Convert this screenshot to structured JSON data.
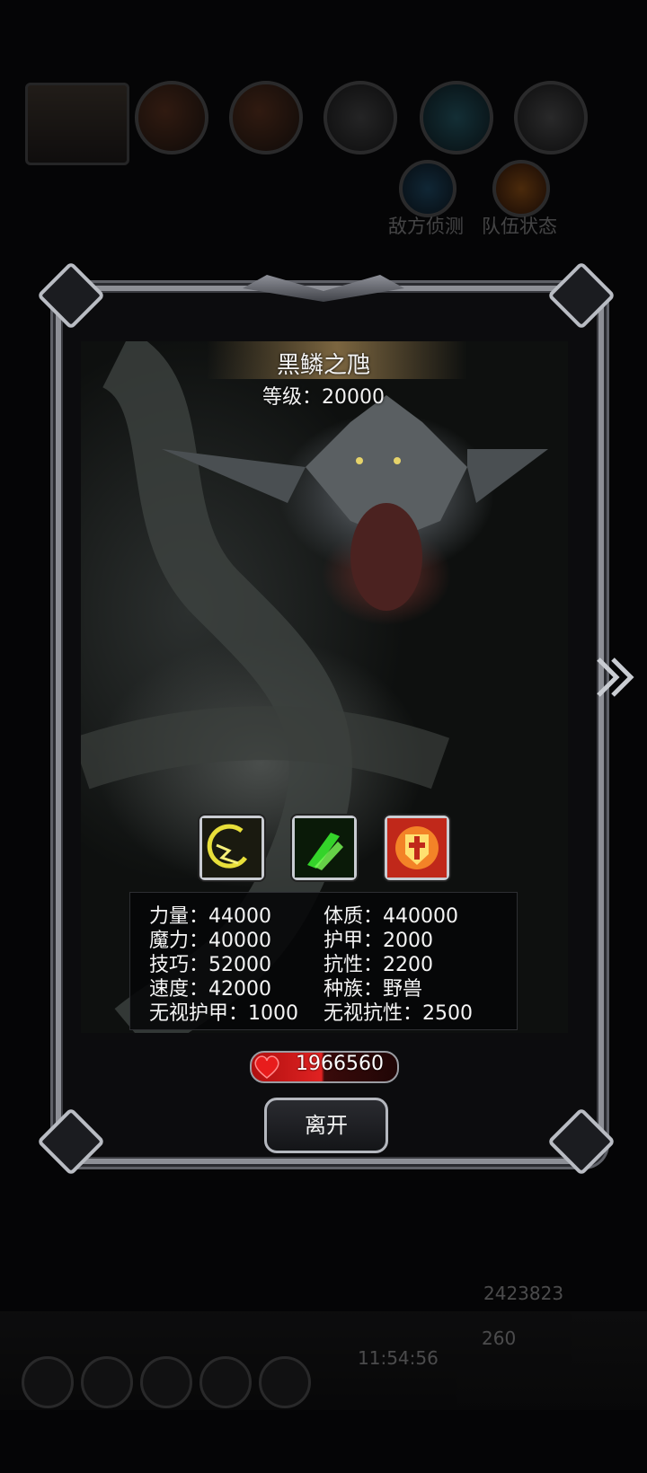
{
  "background": {
    "enemy_scan_label": "敌方侦测",
    "team_status_label": "队伍状态",
    "gold_amount": "2423823",
    "gem_amount": "260",
    "clock": "11:54:56"
  },
  "monster": {
    "name": "黑鳞之虺",
    "level_label": "等级",
    "level_value": "20000"
  },
  "skills": [
    {
      "icon": "lightning-crescent-icon"
    },
    {
      "icon": "green-claw-icon"
    },
    {
      "icon": "holy-shield-icon"
    }
  ],
  "stats": {
    "left": [
      {
        "label": "力量",
        "value": "44000"
      },
      {
        "label": "魔力",
        "value": "40000"
      },
      {
        "label": "技巧",
        "value": "52000"
      },
      {
        "label": "速度",
        "value": "42000"
      },
      {
        "label": "无视护甲",
        "value": "1000"
      }
    ],
    "right": [
      {
        "label": "体质",
        "value": "440000"
      },
      {
        "label": "护甲",
        "value": "2000"
      },
      {
        "label": "抗性",
        "value": "2200"
      },
      {
        "label": "种族",
        "value": "野兽"
      },
      {
        "label": "无视抗性",
        "value": "2500"
      }
    ]
  },
  "hp": {
    "value": "1966560",
    "fill_fraction": 0.5
  },
  "buttons": {
    "leave": "离开"
  },
  "colors": {
    "hp_red": "#e02222",
    "frame_silver": "#8d8f96"
  }
}
